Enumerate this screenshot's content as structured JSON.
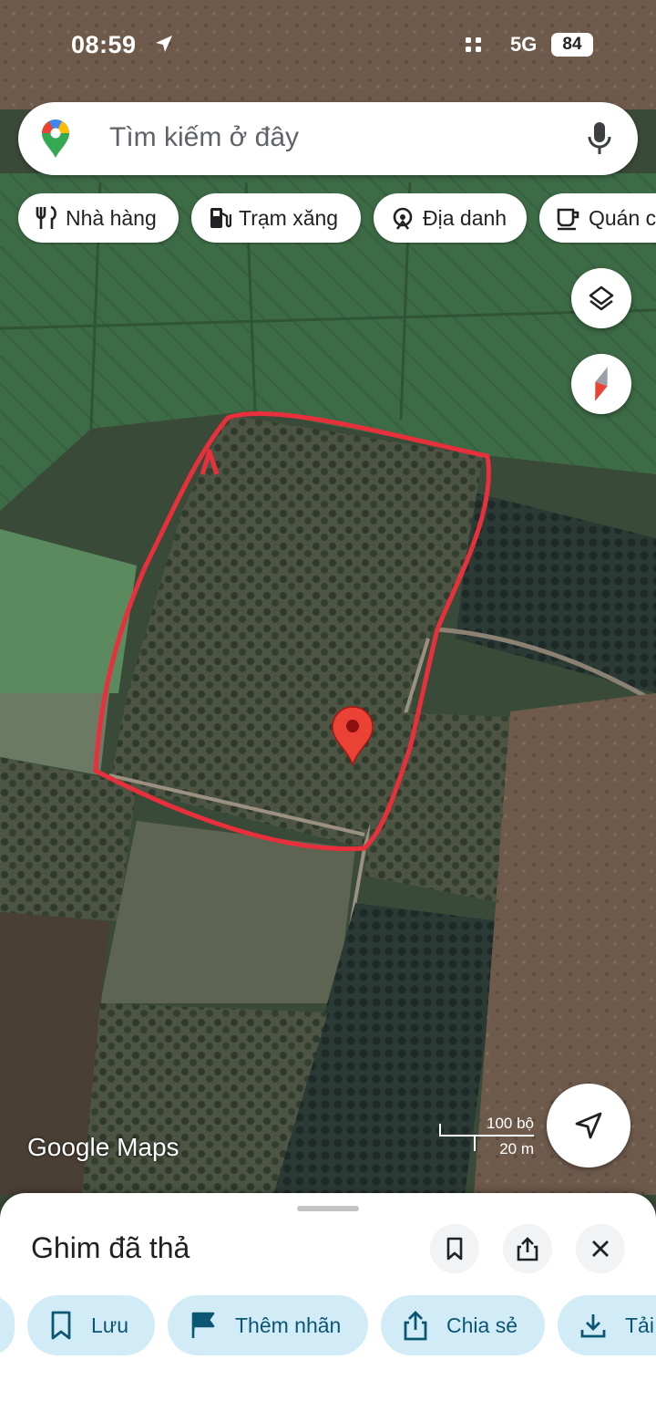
{
  "status_bar": {
    "time": "08:59",
    "network": "5G",
    "battery": "84"
  },
  "search": {
    "placeholder": "Tìm kiếm ở đây"
  },
  "chips": [
    {
      "label": "Nhà hàng",
      "icon": "fork-knife-icon"
    },
    {
      "label": "Trạm xăng",
      "icon": "gas-station-icon"
    },
    {
      "label": "Địa danh",
      "icon": "landmark-icon"
    },
    {
      "label": "Quán c",
      "icon": "coffee-icon"
    }
  ],
  "map": {
    "attribution": "Google Maps",
    "scale": {
      "feet": "100 bộ",
      "meters": "20 m"
    },
    "colors": {
      "boundary": "#e8303c",
      "pin": "#ea4335"
    }
  },
  "sheet": {
    "title": "Ghim đã thả",
    "actions": [
      {
        "label": "Lưu",
        "icon": "bookmark-icon"
      },
      {
        "label": "Thêm nhãn",
        "icon": "flag-icon"
      },
      {
        "label": "Chia sẻ",
        "icon": "share-icon"
      },
      {
        "label": "Tải",
        "icon": "download-icon"
      }
    ]
  }
}
